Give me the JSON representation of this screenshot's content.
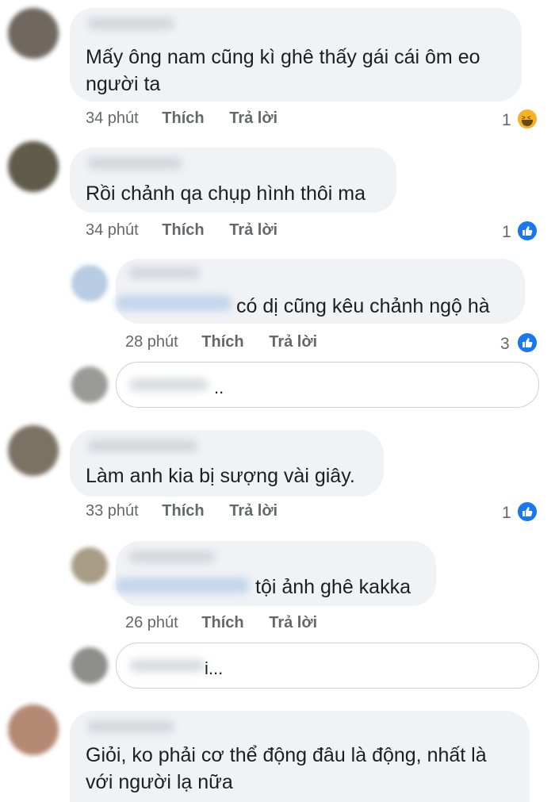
{
  "comments": [
    {
      "text_lines": [
        "Mấy ông nam cũng kì ghê thấy gái cái ôm eo",
        "người ta"
      ],
      "time": "34 phút",
      "like_label": "Thích",
      "reply_label": "Trả lời",
      "reaction_count": "1",
      "reaction_icon": "haha-icon"
    },
    {
      "text_lines": [
        "Rồi chảnh qa chụp hình thôi ma"
      ],
      "time": "34 phút",
      "like_label": "Thích",
      "reply_label": "Trả lời",
      "reaction_count": "1",
      "reaction_icon": "like-icon"
    },
    {
      "text_lines": [
        "có dị cũng kêu chảnh ngộ hà"
      ],
      "time": "28 phút",
      "like_label": "Thích",
      "reply_label": "Trả lời",
      "reaction_count": "3",
      "reaction_icon": "like-icon",
      "is_reply": true
    },
    {
      "text_lines": [
        "Làm anh kia bị sượng vài giây."
      ],
      "time": "33 phút",
      "like_label": "Thích",
      "reply_label": "Trả lời",
      "reaction_count": "1",
      "reaction_icon": "like-icon"
    },
    {
      "text_lines": [
        "tội ảnh ghê kakka"
      ],
      "time": "26 phút",
      "like_label": "Thích",
      "reply_label": "Trả lời",
      "is_reply": true
    },
    {
      "text_lines": [
        "Giỏi, ko phải cơ thể động đâu là động, nhất là",
        "với người lạ nữa"
      ]
    }
  ],
  "reply_inputs": [
    {
      "value": ".."
    },
    {
      "value": "i..."
    }
  ],
  "colors": {
    "bubble": "#f0f2f5",
    "meta_text": "#65676b",
    "like_blue": "#1877f2",
    "haha_yellow": "#f7b125"
  }
}
